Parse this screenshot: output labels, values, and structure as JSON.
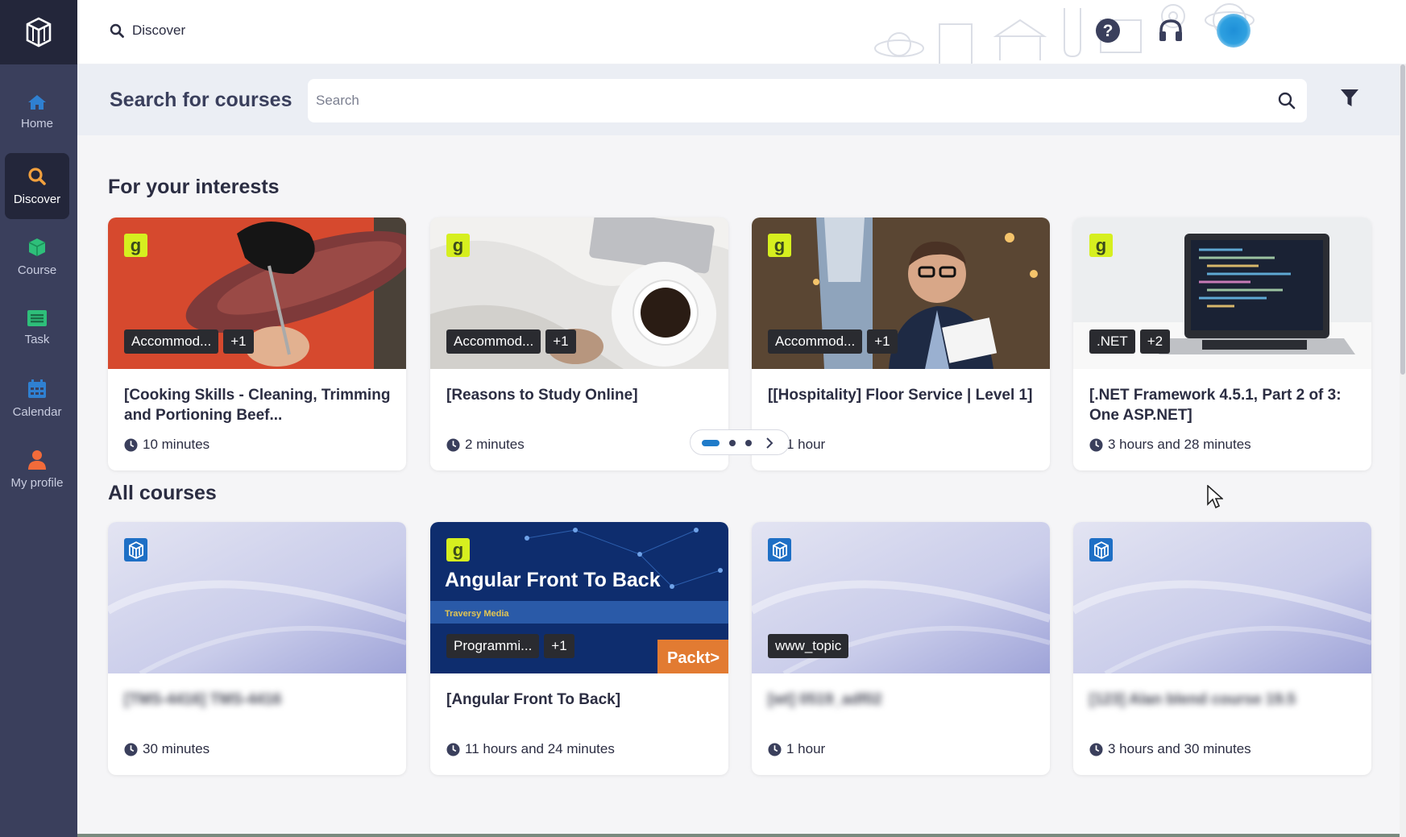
{
  "sidebar": {
    "items": [
      {
        "label": "Home",
        "icon": "home-icon",
        "color": "#2f80d1"
      },
      {
        "label": "Discover",
        "icon": "search-icon",
        "color": "#f2a03d"
      },
      {
        "label": "Course",
        "icon": "cube-icon",
        "color": "#2ebf7a"
      },
      {
        "label": "Task",
        "icon": "task-icon",
        "color": "#2ebf7a"
      },
      {
        "label": "Calendar",
        "icon": "calendar-icon",
        "color": "#2f80d1"
      },
      {
        "label": "My profile",
        "icon": "person-icon",
        "color": "#f26b3a"
      }
    ],
    "active": "Discover"
  },
  "topbar": {
    "breadcrumb": "Discover",
    "icons": [
      "help-icon",
      "headset-icon",
      "avatar"
    ]
  },
  "search": {
    "title": "Search for courses",
    "placeholder": "Search",
    "value": ""
  },
  "sections": {
    "interests_title": "For your interests",
    "all_title": "All courses"
  },
  "interest_cards": [
    {
      "provider": "g",
      "tags": [
        "Accommod...",
        "+1"
      ],
      "title": "[Cooking Skills - Cleaning, Trimming and Portioning Beef...",
      "duration": "10 minutes"
    },
    {
      "provider": "g",
      "tags": [
        "Accommod...",
        "+1"
      ],
      "title": "[Reasons to Study Online]",
      "duration": "2 minutes"
    },
    {
      "provider": "g",
      "tags": [
        "Accommod...",
        "+1"
      ],
      "title": "[[Hospitality] Floor Service | Level 1]",
      "duration": "1 hour"
    },
    {
      "provider": "g",
      "tags": [
        ".NET",
        "+2"
      ],
      "title": "[.NET Framework 4.5.1, Part 2 of 3: One ASP.NET]",
      "duration": "3 hours and 28 minutes"
    }
  ],
  "all_cards": [
    {
      "provider": "cube",
      "tags": [],
      "title": "[TMS-4416] TMS-4416",
      "duration": "30 minutes"
    },
    {
      "provider": "g",
      "tags": [
        "Programmi...",
        "+1"
      ],
      "title": "[Angular Front To Back]",
      "duration": "11 hours and 24 minutes",
      "banner_title": "Angular Front To Back",
      "banner_sub": "Traversy Media",
      "banner_brand": "Packt>"
    },
    {
      "provider": "cube",
      "tags": [
        "www_topic"
      ],
      "title": "[wt] 0519_adf02",
      "duration": "1 hour"
    },
    {
      "provider": "cube",
      "tags": [],
      "title": "[123] Alan blend course 19.5",
      "duration": "3 hours and 30 minutes"
    }
  ],
  "pager": {
    "pages": 3,
    "current": 1
  }
}
